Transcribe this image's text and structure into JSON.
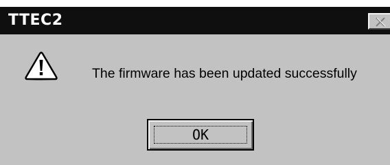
{
  "window": {
    "title": "TTEC2",
    "close_icon": "close-icon",
    "colors": {
      "titlebar": "#0f0f0f",
      "body": "#c2c2c2",
      "title_text": "#ffffff"
    }
  },
  "dialog": {
    "icon": "warning-icon",
    "message": "The firmware has been updated successfully",
    "ok_label": "OK"
  }
}
